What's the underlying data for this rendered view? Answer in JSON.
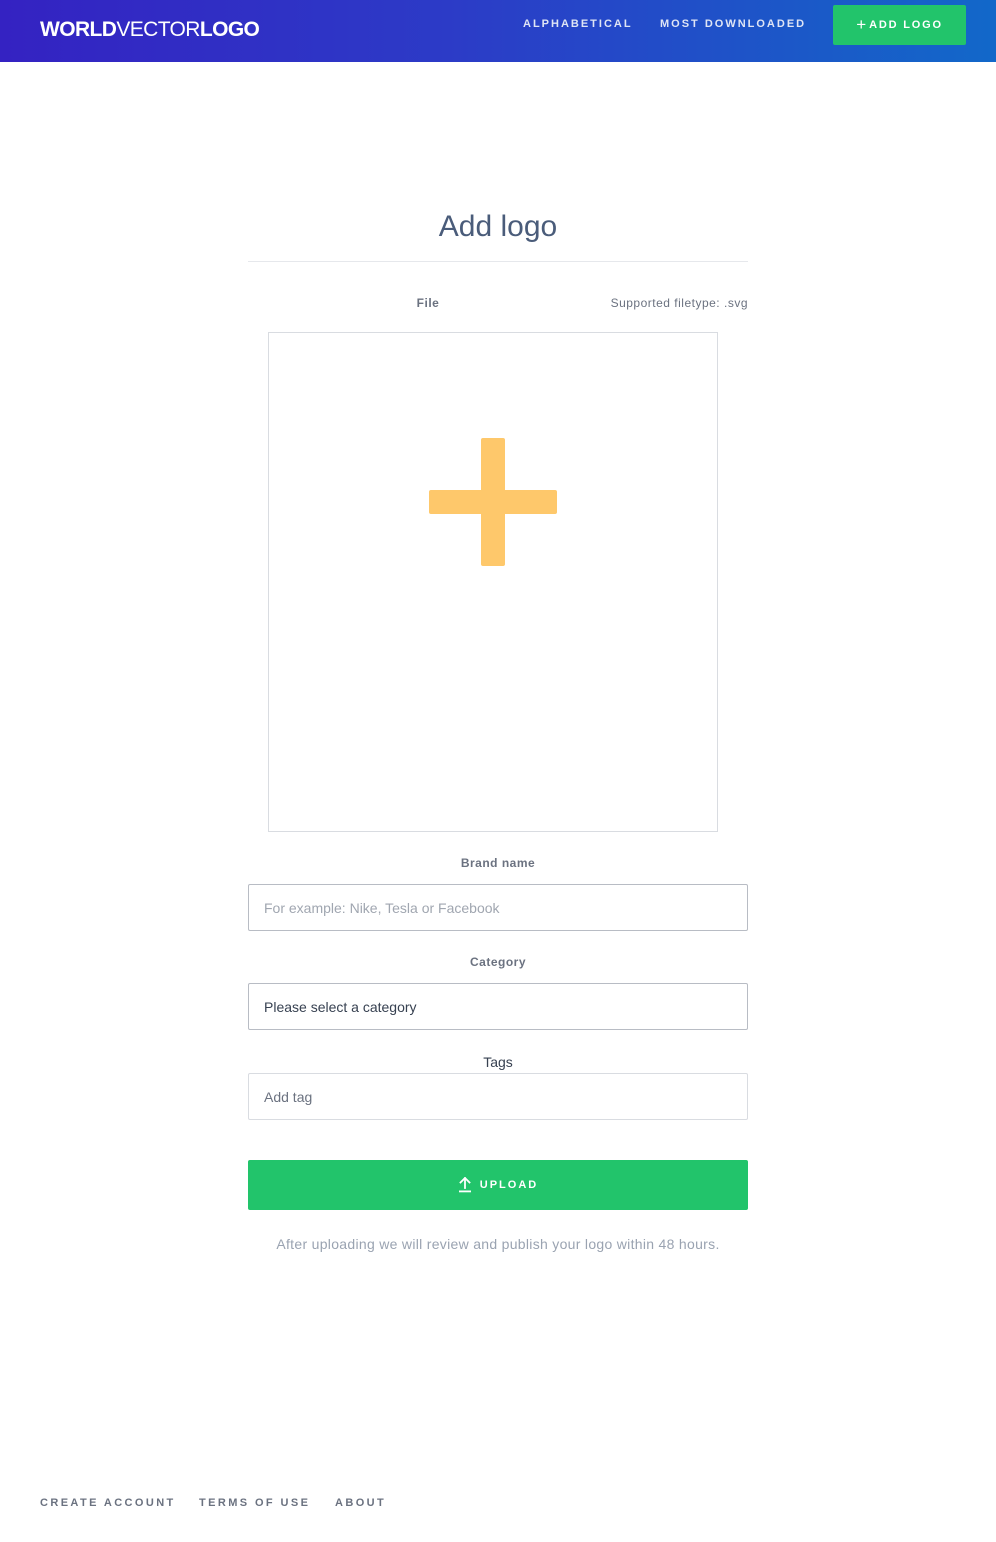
{
  "header": {
    "brand": {
      "part1": "WORLD",
      "part2": "VECTOR",
      "part3": "LOGO"
    },
    "nav": {
      "alphabetical": "ALPHABETICAL",
      "most_downloaded": "MOST DOWNLOADED"
    },
    "add_logo_label": "ADD LOGO",
    "add_logo_icon": "plus-icon"
  },
  "main": {
    "title": "Add logo",
    "file_label": "File",
    "supported_filetype": "Supported filetype: .svg",
    "dropzone_icon": "plus-icon",
    "brand_name_label": "Brand name",
    "brand_name_placeholder": "For example: Nike, Tesla or Facebook",
    "brand_name_value": "",
    "category_label": "Category",
    "category_selected": "Please select a category",
    "tags_label": "Tags",
    "tags_placeholder": "Add tag",
    "upload_label": "UPLOAD",
    "upload_icon": "upload-icon",
    "note": "After uploading we will review and publish your logo within 48 hours."
  },
  "footer": {
    "links": [
      "CREATE ACCOUNT",
      "TERMS OF USE",
      "ABOUT"
    ]
  },
  "colors": {
    "header_gradient_start": "#3422c2",
    "header_gradient_end": "#1268c9",
    "accent_green": "#22c46b",
    "dropzone_plus": "#fec86b"
  }
}
